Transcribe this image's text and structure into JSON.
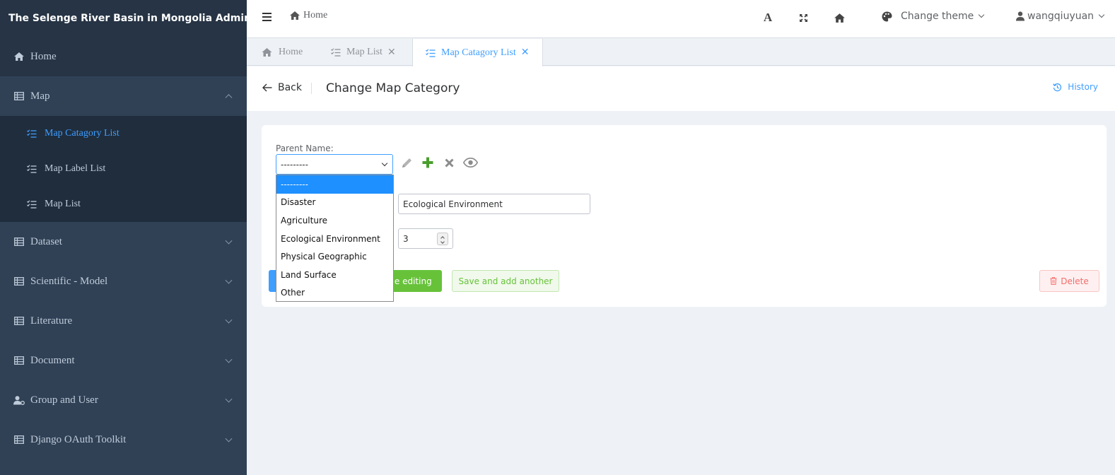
{
  "brand": {
    "title": "The Selenge River Basin in Mongolia Admin"
  },
  "sidebar": {
    "home": "Home",
    "map": "Map",
    "map_sub": [
      "Map Catagory List",
      "Map Label List",
      "Map List"
    ],
    "items": [
      "Dataset",
      "Scientific - Model",
      "Literature",
      "Document",
      "Group and User",
      "Django OAuth Toolkit"
    ]
  },
  "header": {
    "breadcrumb": "Home",
    "theme_label": "Change theme",
    "username": "wangqiuyuan"
  },
  "tabs": [
    {
      "label": "Home"
    },
    {
      "label": "Map List"
    },
    {
      "label": "Map Catagory List"
    }
  ],
  "page": {
    "back_label": "Back",
    "title": "Change Map Category",
    "history_label": "History"
  },
  "form": {
    "parent_label": "Parent Name:",
    "parent_value": "---------",
    "name_value": "Ecological Environment",
    "sort_value": "3",
    "continue_label": "ue editing",
    "add_another_label": "Save and add another",
    "delete_label": "Delete"
  },
  "dropdown": {
    "options": [
      "---------",
      "Disaster",
      "Agriculture",
      "Ecological Environment",
      "Physical Geographic",
      "Land Surface",
      "Other"
    ],
    "selected_index": 0
  },
  "colors": {
    "accent": "#409eff",
    "success": "#67c23a",
    "danger": "#f56c6c",
    "sidebar": "#304156"
  }
}
